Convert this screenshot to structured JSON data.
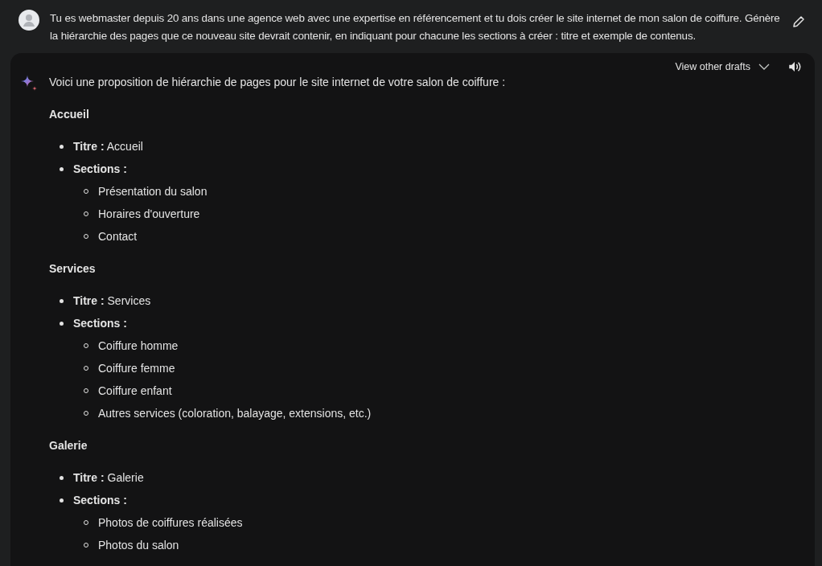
{
  "prompt": {
    "text": "Tu es webmaster depuis 20 ans dans une agence web avec une expertise en référencement et tu dois créer le site internet de mon salon de coiffure. Génère la hiérarchie des pages que ce nouveau site devrait contenir, en indiquant pour chacune les sections à créer : titre et exemple de contenus."
  },
  "response": {
    "drafts_label": "View other drafts",
    "intro": "Voici une proposition de hiérarchie de pages pour le site internet de votre salon de coiffure :",
    "pages": [
      {
        "heading": "Accueil",
        "title": "**Titre :** Accueil",
        "sections_label": "Sections :",
        "sections": [
          "Présentation du salon",
          "Horaires d'ouverture",
          "Contact"
        ]
      },
      {
        "heading": "Services",
        "title": "**Titre :** Services",
        "sections_label": "Sections :",
        "sections": [
          "Coiffure homme",
          "Coiffure femme",
          "Coiffure enfant",
          "Autres services (coloration, balayage, extensions, etc.)"
        ]
      },
      {
        "heading": "Galerie",
        "title": "**Titre :** Galerie",
        "sections_label": "Sections :",
        "sections": [
          "Photos de coiffures réalisées",
          "Photos du salon"
        ]
      }
    ]
  }
}
